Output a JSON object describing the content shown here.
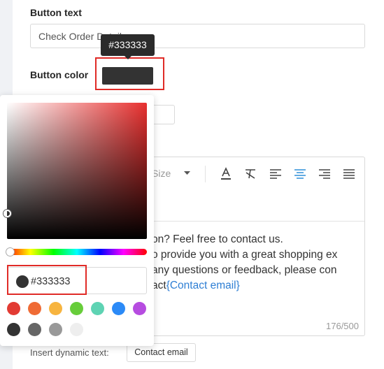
{
  "button_text": {
    "label": "Button text",
    "value": "Check Order Detail"
  },
  "button_color": {
    "label": "Button color",
    "value": "#333333",
    "tooltip": "#333333"
  },
  "editor": {
    "toolbar": {
      "font_size_label": "Size"
    },
    "lines": [
      [
        "on? Feel free to contact us.",
        ""
      ],
      [
        "o provide you with a great shopping ex",
        ""
      ],
      [
        "any questions or feedback, please con",
        ""
      ],
      [
        "act",
        "{Contact email}"
      ]
    ],
    "counter": "176/500",
    "link_color": "#2f7fd4"
  },
  "dynamic_text": {
    "label": "Insert dynamic text:",
    "button": "Contact email"
  },
  "picker": {
    "hex": "#333333",
    "hue": "#e8302f",
    "swatches": [
      "#e23b33",
      "#ef6b35",
      "#f7b43f",
      "#67cd3a",
      "#5ed3b3",
      "#2b8af7",
      "#b64ce0",
      "#333333",
      "#666666",
      "#999999",
      "#eeeeee"
    ]
  },
  "highlight_color": "#e02b27"
}
